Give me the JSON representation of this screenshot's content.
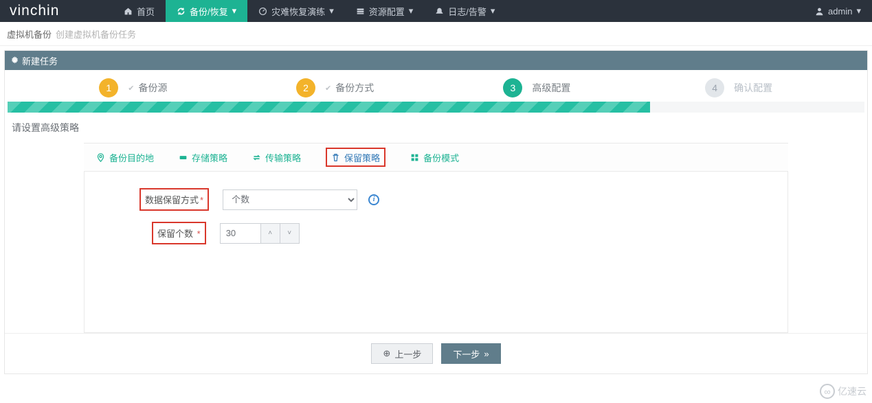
{
  "brand": "vinchin",
  "nav": {
    "home": "首页",
    "backup": "备份/恢复",
    "drill": "灾难恢复演练",
    "resource": "资源配置",
    "logs": "日志/告警"
  },
  "user": {
    "name": "admin"
  },
  "breadcrumb": {
    "main": "虚拟机备份",
    "sub": "创建虚拟机备份任务"
  },
  "panel": {
    "title": "新建任务"
  },
  "wizard": {
    "step1": {
      "num": "1",
      "label": "备份源"
    },
    "step2": {
      "num": "2",
      "label": "备份方式"
    },
    "step3": {
      "num": "3",
      "label": "高级配置"
    },
    "step4": {
      "num": "4",
      "label": "确认配置"
    }
  },
  "section": {
    "title": "请设置高级策略"
  },
  "tabs": {
    "dest": "备份目的地",
    "storage": "存储策略",
    "transfer": "传输策略",
    "retain": "保留策略",
    "mode": "备份模式"
  },
  "form": {
    "retain_mode_label": "数据保留方式",
    "retain_mode_value": "个数",
    "retain_count_label": "保留个数",
    "retain_count_value": "30"
  },
  "buttons": {
    "prev": "上一步",
    "next": "下一步"
  },
  "watermark": "亿速云",
  "glyphs": {
    "check": "✔",
    "caret_down": "▾",
    "arrow_left": "⊕",
    "arrow_right": "»",
    "info": "i",
    "up": "˄",
    "down": "˅"
  }
}
